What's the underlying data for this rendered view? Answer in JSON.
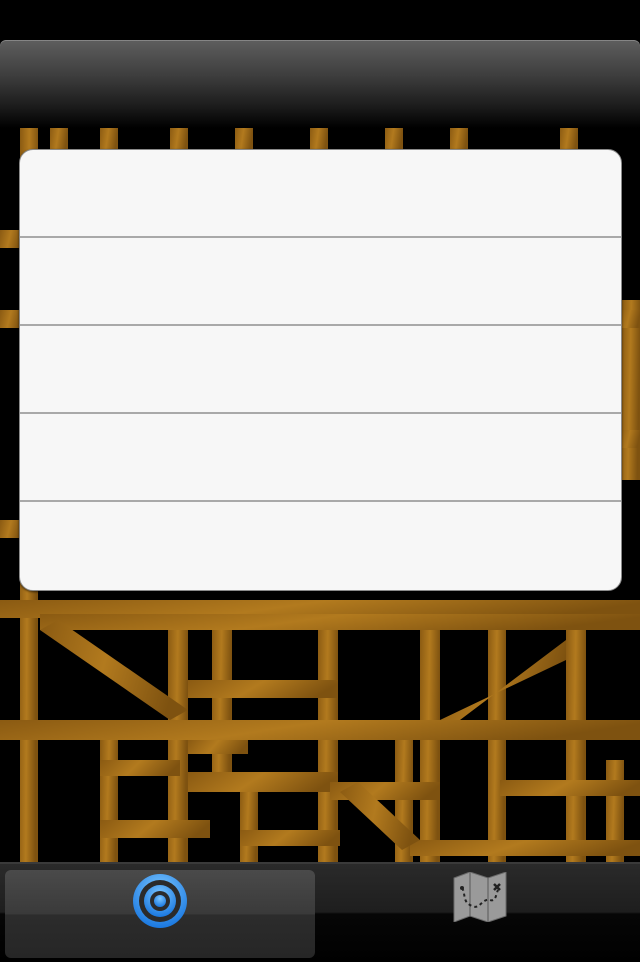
{
  "status_bar": {},
  "nav_bar": {
    "title": ""
  },
  "table": {
    "rows": [
      "",
      "",
      "",
      "",
      ""
    ]
  },
  "tab_bar": {
    "tabs": [
      {
        "icon": "target-icon",
        "selected": true,
        "label": ""
      },
      {
        "icon": "treasure-map-icon",
        "selected": false,
        "label": ""
      }
    ]
  },
  "colors": {
    "map_streets": "#a8701a",
    "map_background": "#000000",
    "table_bg": "#f7f7f7",
    "tab_selected_icon": "#2b8ff0"
  }
}
